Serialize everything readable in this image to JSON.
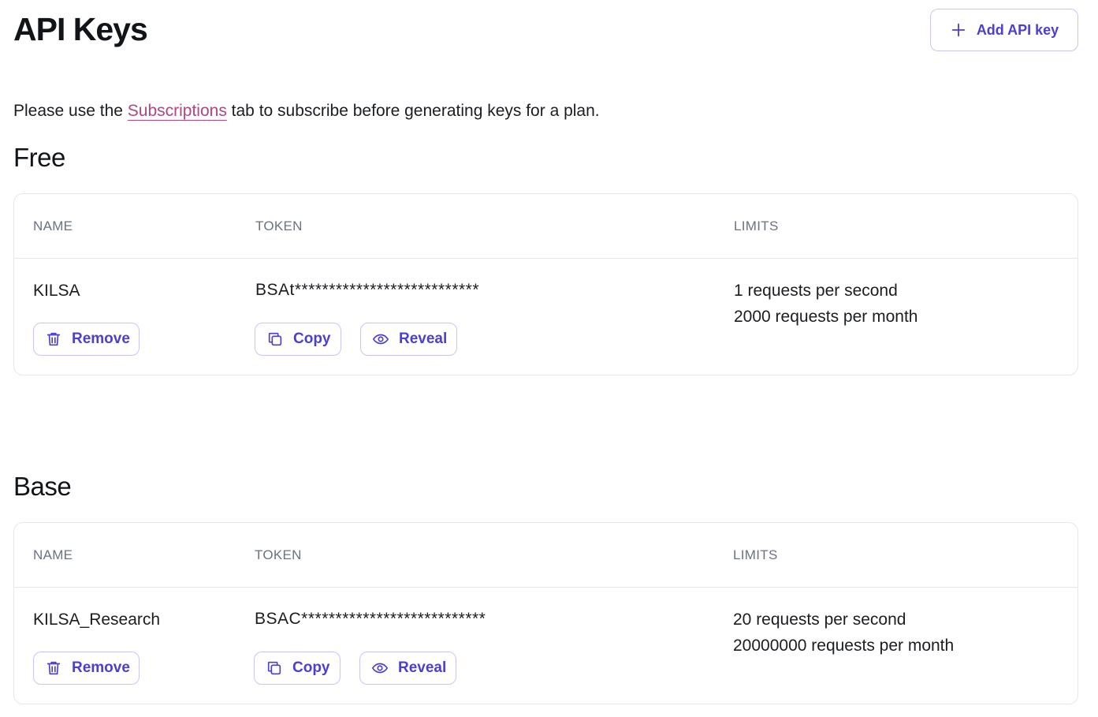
{
  "header": {
    "title": "API Keys",
    "add_button_label": "Add API key"
  },
  "notice": {
    "prefix": "Please use the ",
    "link": "Subscriptions",
    "suffix": " tab to subscribe before generating keys for a plan."
  },
  "columns": {
    "name": "NAME",
    "token": "TOKEN",
    "limits": "LIMITS"
  },
  "actions": {
    "remove": "Remove",
    "copy": "Copy",
    "reveal": "Reveal"
  },
  "plans": [
    {
      "title": "Free",
      "key": {
        "name": "KILSA",
        "token": "BSAt***************************",
        "limit_second": "1 requests per second",
        "limit_month": "2000 requests per month"
      }
    },
    {
      "title": "Base",
      "key": {
        "name": "KILSA_Research",
        "token": "BSAC***************************",
        "limit_second": "20 requests per second",
        "limit_month": "20000000 requests per month"
      }
    }
  ],
  "colors": {
    "accent": "#4b3fd1",
    "link": "#b04682",
    "border": "#e5e7eb",
    "button_border": "#c8c6f0"
  }
}
